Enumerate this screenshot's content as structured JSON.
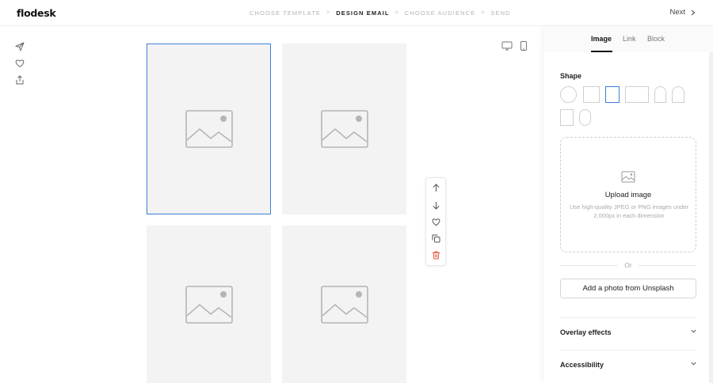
{
  "header": {
    "logo": "flodesk",
    "steps": [
      {
        "label": "CHOOSE TEMPLATE",
        "active": false
      },
      {
        "label": "DESIGN EMAIL",
        "active": true
      },
      {
        "label": "CHOOSE AUDIENCE",
        "active": false
      },
      {
        "label": "SEND",
        "active": false
      }
    ],
    "next_label": "Next"
  },
  "left_rail": {
    "icons": [
      "send-icon",
      "heart-icon",
      "share-icon"
    ]
  },
  "canvas": {
    "slots": [
      {
        "icon": "image-placeholder-icon",
        "selected": true
      },
      {
        "icon": "image-placeholder-icon",
        "selected": false
      },
      {
        "icon": "image-placeholder-icon",
        "selected": false
      },
      {
        "icon": "image-placeholder-icon",
        "selected": false
      }
    ]
  },
  "preview_toggle": {
    "icons": [
      "desktop-icon",
      "mobile-icon"
    ]
  },
  "block_toolbar": {
    "icons": [
      "arrow-up-icon",
      "arrow-down-icon",
      "heart-icon",
      "duplicate-icon",
      "trash-icon"
    ]
  },
  "panel": {
    "tabs": [
      {
        "label": "Image",
        "active": true
      },
      {
        "label": "Link",
        "active": false
      },
      {
        "label": "Block",
        "active": false
      }
    ],
    "shape_label": "Shape",
    "shapes": [
      {
        "name": "circle",
        "selected": false
      },
      {
        "name": "square",
        "selected": false
      },
      {
        "name": "portrait",
        "selected": true
      },
      {
        "name": "landscape",
        "selected": false
      },
      {
        "name": "arch-narrow",
        "selected": false
      },
      {
        "name": "arch",
        "selected": false
      },
      {
        "name": "tall-rectangle",
        "selected": false
      },
      {
        "name": "pill",
        "selected": false
      }
    ],
    "upload": {
      "icon": "image-icon",
      "title": "Upload image",
      "description": "Use high-quality JPEG or PNG images under 2,000px in each dimension"
    },
    "or_label": "Or",
    "unsplash_label": "Add a photo from Unsplash",
    "sections": [
      {
        "label": "Overlay effects",
        "icon": "chevron-down-icon"
      },
      {
        "label": "Accessibility",
        "icon": "chevron-down-icon"
      }
    ]
  },
  "colors": {
    "accent": "#3d7ed6",
    "delete": "#e5533c",
    "placeholder_bg": "#f3f3f3"
  }
}
